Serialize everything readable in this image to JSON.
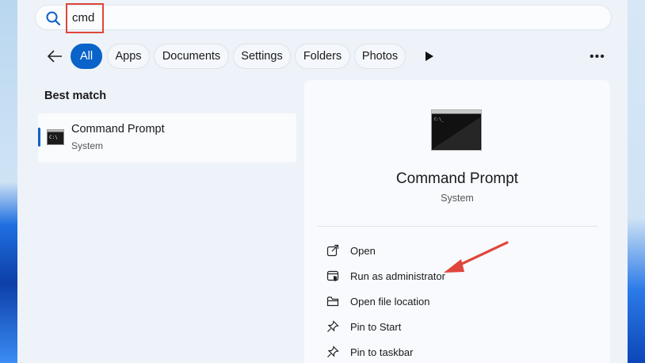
{
  "search": {
    "query": "cmd"
  },
  "filters": {
    "items": [
      {
        "label": "All",
        "active": true
      },
      {
        "label": "Apps",
        "active": false
      },
      {
        "label": "Documents",
        "active": false
      },
      {
        "label": "Settings",
        "active": false
      },
      {
        "label": "Folders",
        "active": false
      },
      {
        "label": "Photos",
        "active": false
      }
    ]
  },
  "best_match": {
    "title": "Best match",
    "result": {
      "name": "Command Prompt",
      "type": "System",
      "icon": "terminal-icon"
    }
  },
  "details": {
    "name": "Command Prompt",
    "type": "System",
    "actions": [
      {
        "label": "Open",
        "icon": "open-external-icon"
      },
      {
        "label": "Run as administrator",
        "icon": "admin-shield-icon"
      },
      {
        "label": "Open file location",
        "icon": "folder-icon"
      },
      {
        "label": "Pin to Start",
        "icon": "pin-icon"
      },
      {
        "label": "Pin to taskbar",
        "icon": "pin-icon"
      }
    ]
  },
  "colors": {
    "accent": "#0a63c9",
    "annotation": "#e0463b"
  }
}
